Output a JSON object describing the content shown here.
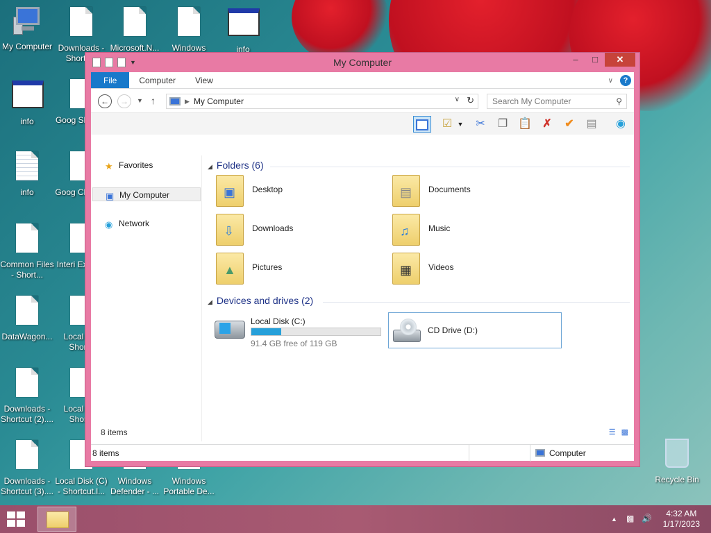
{
  "desktop": {
    "icons": [
      {
        "label": "My Computer"
      },
      {
        "label": "Downloads - Shortcut"
      },
      {
        "label": "Microsoft.N..."
      },
      {
        "label": "Windows"
      },
      {
        "label": "info"
      },
      {
        "label": "info"
      },
      {
        "label": "Goog Shortcu"
      },
      {
        "label": "info"
      },
      {
        "label": "Goog Chrome"
      },
      {
        "label": "Common Files - Short..."
      },
      {
        "label": "Interi Explore"
      },
      {
        "label": "DataWagon..."
      },
      {
        "label": "Local Di - Shorte"
      },
      {
        "label": "Downloads - Shortcut (2)...."
      },
      {
        "label": "Local Di - Shortc"
      },
      {
        "label": "Downloads - Shortcut (3)...."
      },
      {
        "label": "Local Disk (C) - Shortcut.l..."
      },
      {
        "label": "Windows Defender - ..."
      },
      {
        "label": "Windows Portable De..."
      },
      {
        "label": "Recycle Bin"
      }
    ]
  },
  "window": {
    "title": "My Computer",
    "ribbon": {
      "tabs": [
        {
          "label": "File"
        },
        {
          "label": "Computer"
        },
        {
          "label": "View"
        }
      ],
      "help": "?"
    },
    "address": {
      "path": "My Computer",
      "search_placeholder": "Search My Computer"
    },
    "nav": {
      "items": [
        {
          "label": "Favorites",
          "icon": "star-icon"
        },
        {
          "label": "My Computer",
          "icon": "computer-icon"
        },
        {
          "label": "Network",
          "icon": "network-icon"
        }
      ]
    },
    "content": {
      "folders_header": "Folders (6)",
      "folders": [
        {
          "label": "Desktop",
          "icon": "desktop-folder-icon"
        },
        {
          "label": "Documents",
          "icon": "documents-folder-icon"
        },
        {
          "label": "Downloads",
          "icon": "downloads-folder-icon"
        },
        {
          "label": "Music",
          "icon": "music-folder-icon"
        },
        {
          "label": "Pictures",
          "icon": "pictures-folder-icon"
        },
        {
          "label": "Videos",
          "icon": "videos-folder-icon"
        }
      ],
      "drives_header": "Devices and drives (2)",
      "drives": [
        {
          "label": "Local Disk (C:)",
          "free_text": "91.4 GB free of 119 GB",
          "used_fraction": 0.232,
          "icon": "hard-drive-icon"
        },
        {
          "label": "CD Drive (D:)",
          "icon": "cd-drive-icon"
        }
      ]
    },
    "item_count": "8 items",
    "status": {
      "item_count": "8 items",
      "zone": "Computer"
    }
  },
  "taskbar": {
    "time": "4:32 AM",
    "date": "1/17/2023"
  },
  "colors": {
    "window_frame": "#e87aa4",
    "accent": "#1979ca",
    "group_header": "#1e3287",
    "drive_bar": "#26a0da"
  }
}
